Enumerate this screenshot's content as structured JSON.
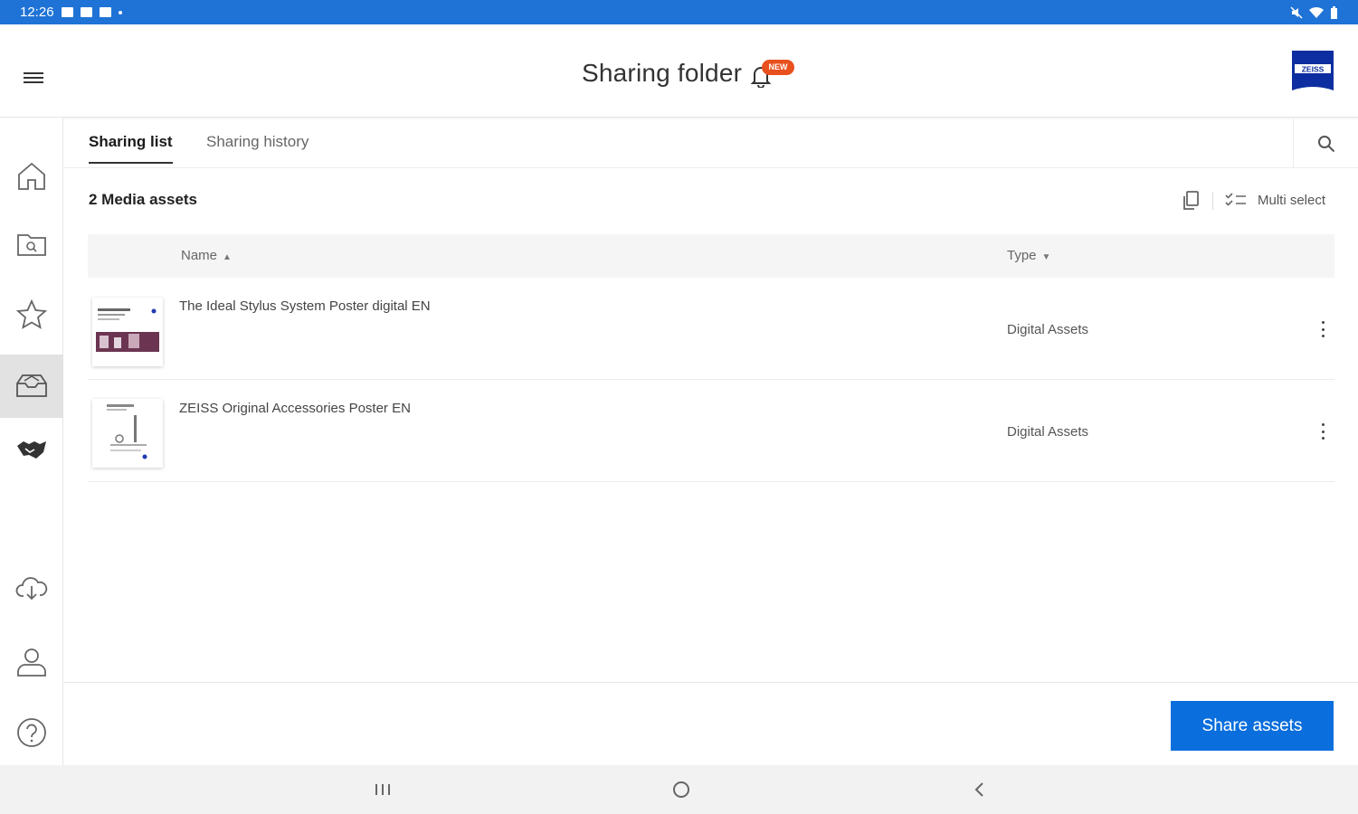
{
  "status_bar": {
    "time": "12:26"
  },
  "header": {
    "title": "Sharing folder",
    "badge": "NEW",
    "logo_text": "ZEISS"
  },
  "rail": {
    "items": [
      {
        "name": "home-icon",
        "active": false
      },
      {
        "name": "folder-search-icon",
        "active": false
      },
      {
        "name": "star-icon",
        "active": false
      },
      {
        "name": "sharing-folder-icon",
        "active": true
      },
      {
        "name": "handshake-icon",
        "active": false
      },
      {
        "name": "cloud-download-icon",
        "active": false
      },
      {
        "name": "user-icon",
        "active": false
      },
      {
        "name": "help-icon",
        "active": false
      }
    ]
  },
  "tabs": [
    {
      "label": "Sharing list",
      "active": true
    },
    {
      "label": "Sharing history",
      "active": false
    }
  ],
  "list": {
    "count_label": "2 Media assets",
    "multi_select_label": "Multi select",
    "columns": {
      "name": "Name",
      "type": "Type"
    },
    "rows": [
      {
        "name": "The Ideal Stylus System Poster digital EN",
        "type": "Digital Assets"
      },
      {
        "name": "ZEISS Original Accessories Poster EN",
        "type": "Digital Assets"
      }
    ]
  },
  "footer": {
    "share_label": "Share assets"
  },
  "colors": {
    "status_bar": "#1f73d6",
    "primary_button": "#0a6edc",
    "badge": "#e8501d",
    "zeiss_blue": "#0d2ea0"
  }
}
